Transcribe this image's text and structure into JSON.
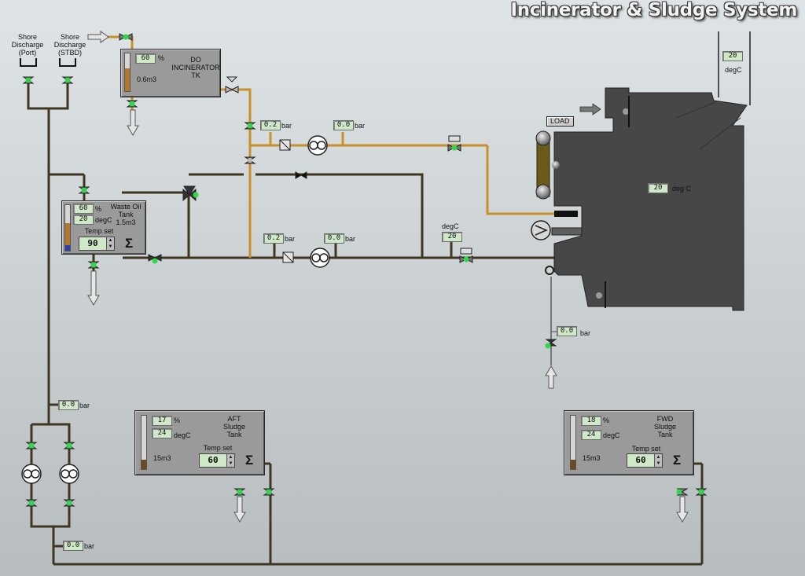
{
  "title": "Incinerator & Sludge System",
  "discharge": {
    "port_label": "Shore\nDischarge\n(Port)",
    "stbd_label": "Shore\nDischarge\n(STBD)"
  },
  "do_tank": {
    "name": "DO\nINCINERATOR\nTK",
    "level_pct": "60",
    "level_fraction": 0.6,
    "volume": "0.6m3"
  },
  "waste_oil_tank": {
    "name": "Waste Oil\nTank\n1.5m3",
    "level_pct": "60",
    "level_fraction": 0.6,
    "temp": "20",
    "temp_set_label": "Temp set",
    "temp_set": "90"
  },
  "aft_sludge_tank": {
    "name": "AFT\nSludge\nTank",
    "level_pct": "17",
    "level_fraction": 0.17,
    "temp": "24",
    "volume": "15m3",
    "temp_set_label": "Temp set",
    "temp_set": "60"
  },
  "fwd_sludge_tank": {
    "name": "FWD\nSludge\nTank",
    "level_pct": "18",
    "level_fraction": 0.18,
    "temp": "24",
    "volume": "15m3",
    "temp_set_label": "Temp set",
    "temp_set": "60"
  },
  "incinerator": {
    "temp": "20",
    "temp_unit": "deg C",
    "load_label": "LOAD",
    "exhaust_temp": "20",
    "exhaust_unit": "degC"
  },
  "readouts": {
    "do_pump_suction": "0.2",
    "do_pump_discharge": "0.0",
    "sludge_pump_suction": "0.2",
    "sludge_pump_discharge": "0.0",
    "sludge_line_temp": "20",
    "sludge_line_temp_label": "degC",
    "air_pressure": "0.0",
    "transfer_pump_discharge": "0.0",
    "transfer_pump_suction": "0.0"
  },
  "units": {
    "pct": "%",
    "degc": "degC",
    "bar": "bar"
  },
  "colors": {
    "oil_line": "#c8902a",
    "sludge_line": "#3e3620",
    "valve_open": "#2fd84a",
    "incinerator": "#474747"
  },
  "icons": {
    "sigma": "Σ",
    "spin_up": "▲",
    "spin_down": "▼"
  }
}
